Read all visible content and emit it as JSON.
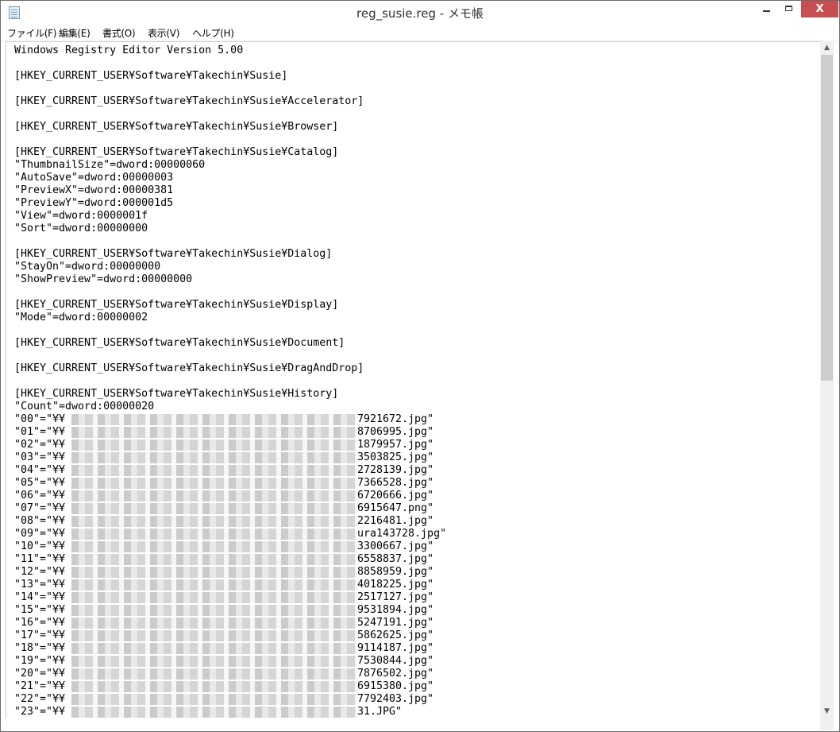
{
  "window": {
    "title": "reg_susie.reg - メモ帳",
    "close_glyph": "X"
  },
  "menu": {
    "items": [
      "ファイル(F)",
      "編集(E)",
      "書式(O)",
      "表示(V)",
      "ヘルプ(H)"
    ]
  },
  "editor": {
    "lines": [
      "Windows Registry Editor Version 5.00",
      "",
      "[HKEY_CURRENT_USER¥Software¥Takechin¥Susie]",
      "",
      "[HKEY_CURRENT_USER¥Software¥Takechin¥Susie¥Accelerator]",
      "",
      "[HKEY_CURRENT_USER¥Software¥Takechin¥Susie¥Browser]",
      "",
      "[HKEY_CURRENT_USER¥Software¥Takechin¥Susie¥Catalog]",
      "\"ThumbnailSize\"=dword:00000060",
      "\"AutoSave\"=dword:00000003",
      "\"PreviewX\"=dword:00000381",
      "\"PreviewY\"=dword:000001d5",
      "\"View\"=dword:0000001f",
      "\"Sort\"=dword:00000000",
      "",
      "[HKEY_CURRENT_USER¥Software¥Takechin¥Susie¥Dialog]",
      "\"StayOn\"=dword:00000000",
      "\"ShowPreview\"=dword:00000000",
      "",
      "[HKEY_CURRENT_USER¥Software¥Takechin¥Susie¥Display]",
      "\"Mode\"=dword:00000002",
      "",
      "[HKEY_CURRENT_USER¥Software¥Takechin¥Susie¥Document]",
      "",
      "[HKEY_CURRENT_USER¥Software¥Takechin¥Susie¥DragAndDrop]",
      "",
      "[HKEY_CURRENT_USER¥Software¥Takechin¥Susie¥History]",
      "\"Count\"=dword:00000020"
    ],
    "history_entries": [
      {
        "prefix": "\"00\"=\"¥¥",
        "suffix": "7921672.jpg\""
      },
      {
        "prefix": "\"01\"=\"¥¥",
        "suffix": "8706995.jpg\""
      },
      {
        "prefix": "\"02\"=\"¥¥",
        "suffix": "1879957.jpg\""
      },
      {
        "prefix": "\"03\"=\"¥¥",
        "suffix": "3503825.jpg\""
      },
      {
        "prefix": "\"04\"=\"¥¥",
        "suffix": "2728139.jpg\""
      },
      {
        "prefix": "\"05\"=\"¥¥",
        "suffix": "7366528.jpg\""
      },
      {
        "prefix": "\"06\"=\"¥¥",
        "suffix": "6720666.jpg\""
      },
      {
        "prefix": "\"07\"=\"¥¥",
        "suffix": "6915647.png\""
      },
      {
        "prefix": "\"08\"=\"¥¥",
        "suffix": "2216481.jpg\""
      },
      {
        "prefix": "\"09\"=\"¥¥",
        "suffix": "ura143728.jpg\""
      },
      {
        "prefix": "\"10\"=\"¥¥",
        "suffix": "3300667.jpg\""
      },
      {
        "prefix": "\"11\"=\"¥¥",
        "suffix": "6558837.jpg\""
      },
      {
        "prefix": "\"12\"=\"¥¥",
        "suffix": "8858959.jpg\""
      },
      {
        "prefix": "\"13\"=\"¥¥",
        "suffix": "4018225.jpg\""
      },
      {
        "prefix": "\"14\"=\"¥¥",
        "suffix": "2517127.jpg\""
      },
      {
        "prefix": "\"15\"=\"¥¥",
        "suffix": "9531894.jpg\""
      },
      {
        "prefix": "\"16\"=\"¥¥",
        "suffix": "5247191.jpg\""
      },
      {
        "prefix": "\"17\"=\"¥¥",
        "suffix": "5862625.jpg\""
      },
      {
        "prefix": "\"18\"=\"¥¥",
        "suffix": "9114187.jpg\""
      },
      {
        "prefix": "\"19\"=\"¥¥",
        "suffix": "7530844.jpg\""
      },
      {
        "prefix": "\"20\"=\"¥¥",
        "suffix": "7876502.jpg\""
      },
      {
        "prefix": "\"21\"=\"¥¥",
        "suffix": "6915380.jpg\""
      },
      {
        "prefix": "\"22\"=\"¥¥",
        "suffix": "7792403.jpg\""
      },
      {
        "prefix": "\"23\"=\"¥¥",
        "suffix": "31.JPG\""
      }
    ]
  },
  "scrollbar": {
    "up_glyph": "▲",
    "down_glyph": "▼",
    "scroll_position": 0
  }
}
